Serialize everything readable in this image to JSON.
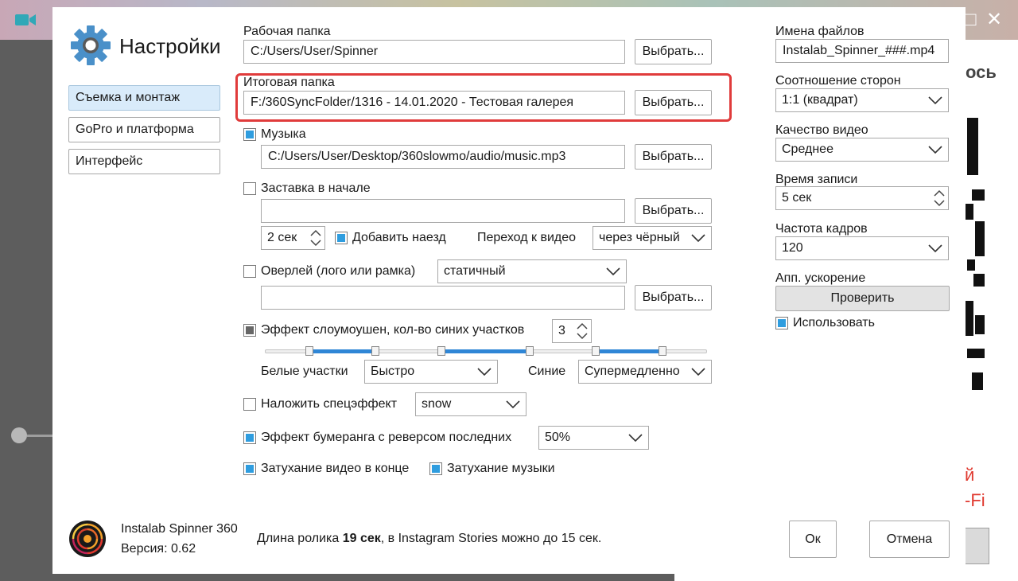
{
  "background": {
    "right_text_1": "ось",
    "right_red_1": "й",
    "right_red_2": "-Fi",
    "window_controls": [
      "□",
      "✕"
    ]
  },
  "dialog": {
    "title": "Настройки",
    "nav": [
      "Съемка и монтаж",
      "GoPro и платформа",
      "Интерфейс"
    ],
    "work_folder": {
      "label": "Рабочая папка",
      "value": "C:/Users/User/Spinner",
      "button": "Выбрать..."
    },
    "output_folder": {
      "label": "Итоговая папка",
      "value": "F:/360SyncFolder/1316 - 14.01.2020 - Тестовая галерея",
      "button": "Выбрать..."
    },
    "music": {
      "label": "Музыка",
      "checked": true,
      "value": "C:/Users/User/Desktop/360slowmo/audio/music.mp3",
      "button": "Выбрать..."
    },
    "intro": {
      "label": "Заставка в начале",
      "checked": false,
      "value": "",
      "button": "Выбрать...",
      "duration": "2 сек",
      "zoom_label": "Добавить наезд",
      "zoom_checked": true,
      "transition_label": "Переход к видео",
      "transition_value": "через чёрный"
    },
    "overlay": {
      "label": "Оверлей (лого или рамка)",
      "checked": false,
      "type": "статичный",
      "value": "",
      "button": "Выбрать..."
    },
    "slowmo": {
      "label": "Эффект слоумоушен, кол-во синих участков",
      "count": "3",
      "white_label": "Белые участки",
      "white_value": "Быстро",
      "blue_label": "Синие",
      "blue_value": "Супермедленно"
    },
    "special_effect": {
      "label": "Наложить спецэффект",
      "checked": false,
      "value": "snow"
    },
    "boomerang": {
      "label": "Эффект бумеранга с реверсом последних",
      "checked": true,
      "value": "50%"
    },
    "fade_video": {
      "label": "Затухание видео в конце",
      "checked": true
    },
    "fade_music": {
      "label": "Затухание музыки",
      "checked": true
    },
    "file_names": {
      "label": "Имена файлов",
      "value": "Instalab_Spinner_###.mp4"
    },
    "aspect": {
      "label": "Соотношение сторон",
      "value": "1:1 (квадрат)"
    },
    "quality": {
      "label": "Качество видео",
      "value": "Среднее"
    },
    "record_time": {
      "label": "Время записи",
      "value": "5 сек"
    },
    "fps": {
      "label": "Частота кадров",
      "value": "120"
    },
    "hw_accel": {
      "label": "Апп. ускорение",
      "button": "Проверить",
      "use_label": "Использовать",
      "use_checked": true
    },
    "app_name": "Instalab Spinner 360",
    "version": "Версия: 0.62",
    "footer": {
      "prefix": "Длина ролика ",
      "length": "19 сек",
      "suffix": ", в Instagram Stories можно до 15 сек."
    },
    "ok": "Ок",
    "cancel": "Отмена"
  },
  "colors": {
    "accent": "#2f9ddf",
    "highlight": "#e03b3b",
    "active_nav": "#d9ebfa"
  },
  "icons": [
    "gear-icon",
    "chevron-down-icon",
    "spin-arrows-icon",
    "app-logo",
    "video-camera-icon"
  ]
}
